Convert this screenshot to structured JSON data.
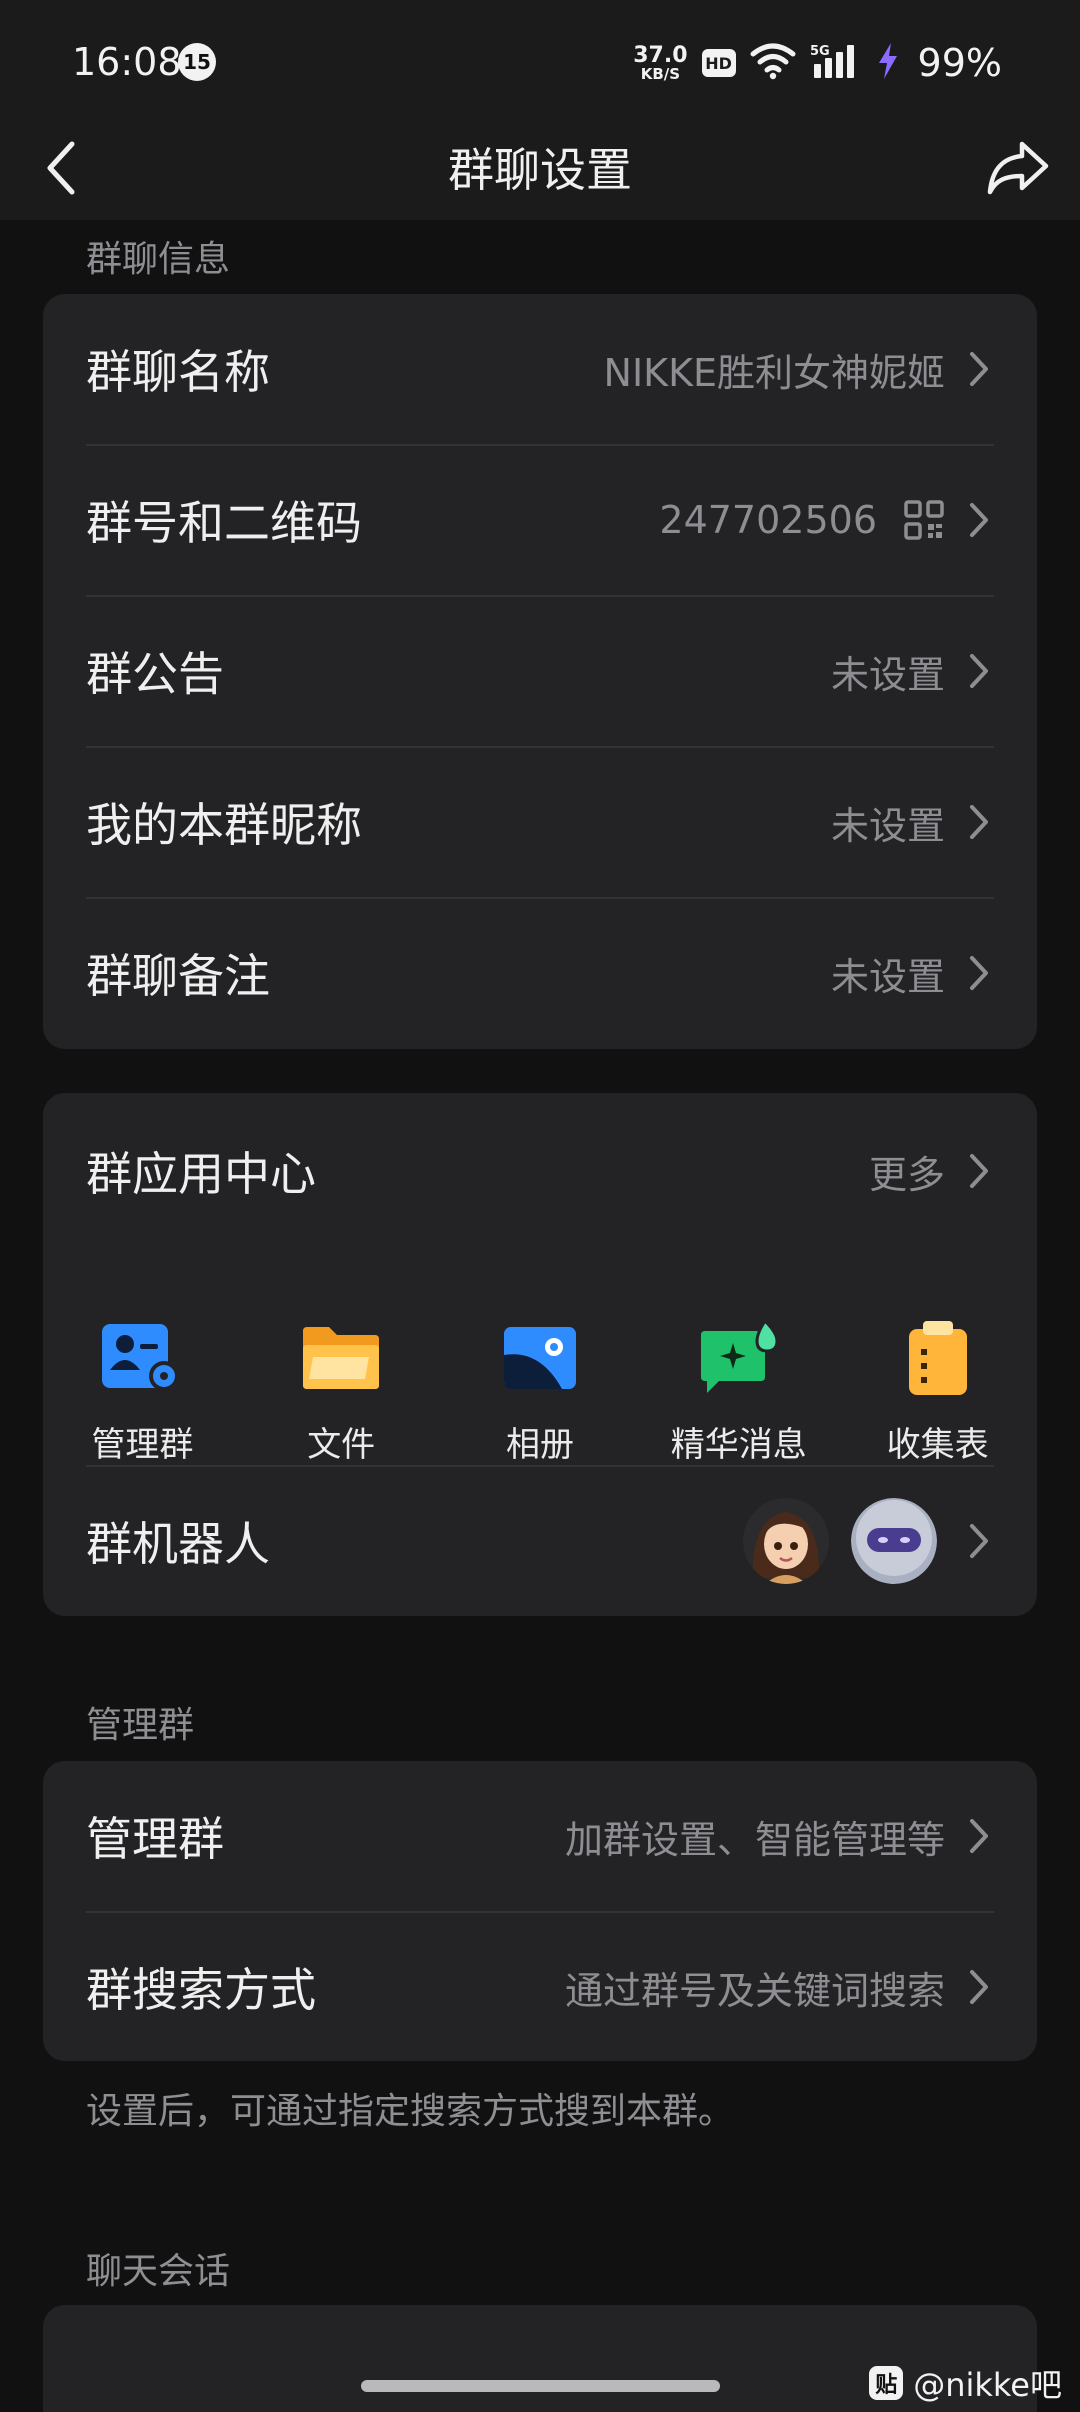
{
  "status_bar": {
    "time": "16:08",
    "notification_count": "15",
    "net_speed_value": "37.0",
    "net_speed_unit": "KB/S",
    "hd_label": "HD",
    "network_label": "5G",
    "battery": "99%"
  },
  "nav": {
    "title": "群聊设置",
    "back_icon": "chevron-left-icon",
    "share_icon": "share-icon"
  },
  "group_info": {
    "section_title": "群聊信息",
    "rows": [
      {
        "label": "群聊名称",
        "value": "NIKKE胜利女神妮姬"
      },
      {
        "label": "群号和二维码",
        "value": "247702506"
      },
      {
        "label": "群公告",
        "value": "未设置"
      },
      {
        "label": "我的本群昵称",
        "value": "未设置"
      },
      {
        "label": "群聊备注",
        "value": "未设置"
      }
    ]
  },
  "app_center": {
    "title": "群应用中心",
    "more": "更多",
    "apps": [
      {
        "label": "管理群",
        "icon": "manage-group-icon"
      },
      {
        "label": "文件",
        "icon": "folder-icon"
      },
      {
        "label": "相册",
        "icon": "album-icon"
      },
      {
        "label": "精华消息",
        "icon": "essence-message-icon"
      },
      {
        "label": "收集表",
        "icon": "clipboard-icon"
      }
    ],
    "robot_label": "群机器人"
  },
  "manage": {
    "section_title": "管理群",
    "rows": [
      {
        "label": "管理群",
        "value": "加群设置、智能管理等"
      },
      {
        "label": "群搜索方式",
        "value": "通过群号及关键词搜索"
      }
    ],
    "hint": "设置后，可通过指定搜索方式搜到本群。"
  },
  "chat_session": {
    "section_title": "聊天会话"
  },
  "watermark": {
    "logo": "贴",
    "text": "@nikke吧"
  },
  "colors": {
    "background": "#111112",
    "card": "#232326",
    "secondary_text": "#8e8e92",
    "folder": "#ffb43a",
    "album": "#2f8cff",
    "essence": "#1fc26a",
    "clipboard": "#ffb43a",
    "manage": "#2f8cff"
  }
}
